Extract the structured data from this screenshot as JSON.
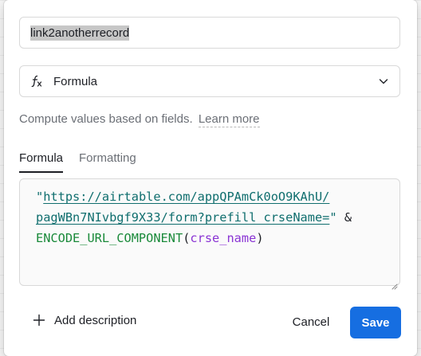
{
  "field": {
    "name_value": "link2anotherrecord"
  },
  "type_select": {
    "icon": "formula-fx-icon",
    "selected": "Formula",
    "chevron": "chevron-down-icon"
  },
  "helper": {
    "text": "Compute values based on fields.",
    "learn_more": "Learn more"
  },
  "tabs": [
    {
      "label": "Formula",
      "active": true
    },
    {
      "label": "Formatting",
      "active": false
    }
  ],
  "formula": {
    "line1": {
      "quote_open": "\"",
      "url_part": "https://airtable.com/appQPAmCk0oO9KAhU/"
    },
    "line2": {
      "url_part": "pagWBn7NIvbgf9X33/form?prefill_crseName=",
      "quote_close": "\"",
      "operator": " &"
    },
    "line3": {
      "function": "ENCODE_URL_COMPONENT",
      "open_paren": "(",
      "argument": "crse_name",
      "close_paren": ")"
    }
  },
  "footer": {
    "add_description_label": "Add description",
    "cancel_label": "Cancel",
    "save_label": "Save"
  },
  "colors": {
    "save_button": "#166ee1",
    "string_literal": "#0f6e6e",
    "function_name": "#1a8a3a",
    "field_reference": "#8a34d4"
  }
}
